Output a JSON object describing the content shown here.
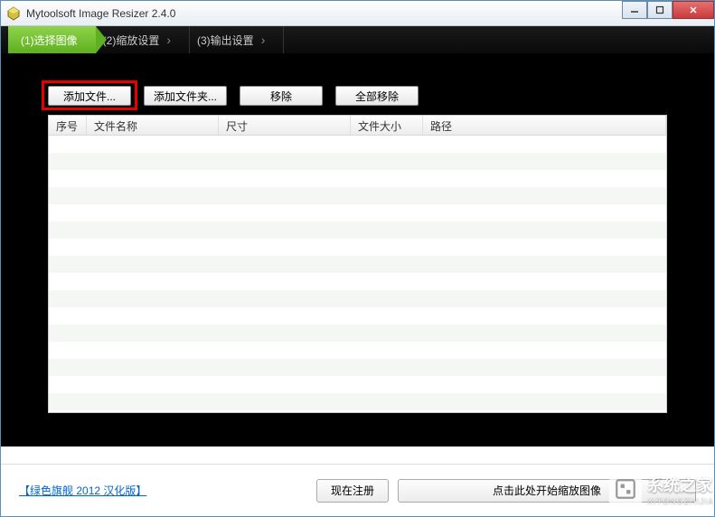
{
  "window": {
    "title": "Mytoolsoft Image Resizer 2.4.0"
  },
  "tabs": {
    "t1": "(1)选择图像",
    "t2": "(2)缩放设置",
    "t3": "(3)输出设置"
  },
  "toolbar": {
    "add_file": "添加文件...",
    "add_folder": "添加文件夹...",
    "remove": "移除",
    "remove_all": "全部移除"
  },
  "table": {
    "headers": {
      "seq": "序号",
      "name": "文件名称",
      "size": "尺寸",
      "fsize": "文件大小",
      "path": "路径"
    }
  },
  "footer": {
    "link": "绿色旗舰 2012 汉化版",
    "register": "现在注册",
    "start": "点击此处开始缩放图像"
  },
  "watermark": {
    "text": "系统之家",
    "sub": "XITONGZHIJIA"
  }
}
